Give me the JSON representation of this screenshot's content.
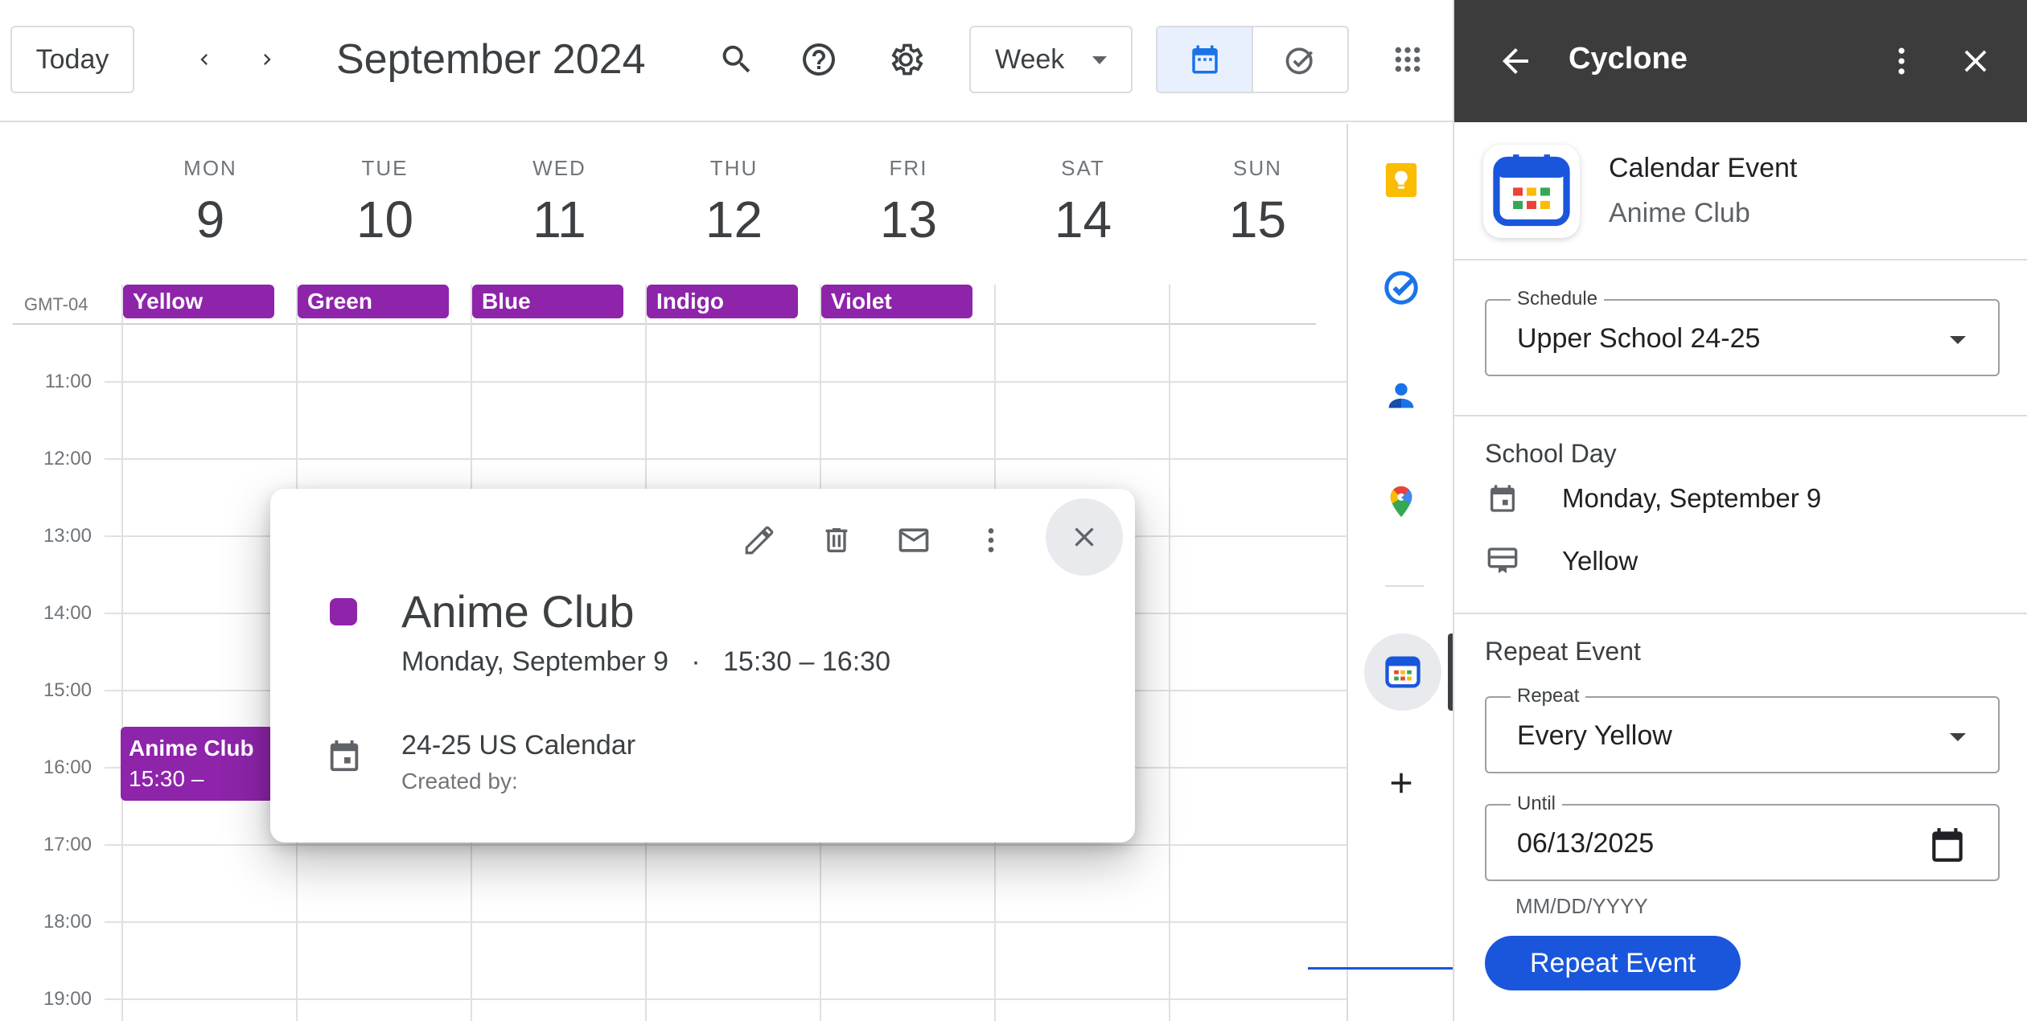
{
  "header": {
    "today_label": "Today",
    "month_title": "September 2024",
    "view_label": "Week"
  },
  "calendar": {
    "timezone": "GMT-04",
    "days": [
      {
        "name": "MON",
        "num": "9"
      },
      {
        "name": "TUE",
        "num": "10"
      },
      {
        "name": "WED",
        "num": "11"
      },
      {
        "name": "THU",
        "num": "12"
      },
      {
        "name": "FRI",
        "num": "13"
      },
      {
        "name": "SAT",
        "num": "14"
      },
      {
        "name": "SUN",
        "num": "15"
      }
    ],
    "day_chips": [
      "Yellow",
      "Green",
      "Blue",
      "Indigo",
      "Violet"
    ],
    "times": [
      "11:00",
      "12:00",
      "13:00",
      "14:00",
      "15:00",
      "16:00",
      "17:00",
      "18:00",
      "19:00"
    ],
    "event": {
      "title": "Anime Club",
      "time": "15:30 – 16:30"
    },
    "event_color": "#8e24aa"
  },
  "popup": {
    "title": "Anime Club",
    "date": "Monday, September 9",
    "separator": "·",
    "time": "15:30 – 16:30",
    "calendar_name": "24-25 US Calendar",
    "created_by": "Created by:"
  },
  "panel": {
    "title": "Cyclone",
    "card_title": "Calendar Event",
    "card_subtitle": "Anime Club",
    "schedule": {
      "label": "Schedule",
      "value": "Upper School 24-25"
    },
    "school_day": {
      "heading": "School Day",
      "date": "Monday, September 9",
      "day_color": "Yellow"
    },
    "repeat_event": {
      "heading": "Repeat Event",
      "repeat": {
        "label": "Repeat",
        "value": "Every Yellow"
      },
      "until": {
        "label": "Until",
        "value": "06/13/2025"
      },
      "date_hint": "MM/DD/YYYY",
      "button_label": "Repeat Event"
    },
    "accent_color": "#1a56db"
  },
  "icons": {
    "header": [
      "chevron-left-icon",
      "chevron-right-icon",
      "search-icon",
      "help-icon",
      "settings-icon",
      "calendar-icon",
      "task-check-icon",
      "apps-grid-icon"
    ],
    "rail": [
      "keep-icon",
      "tasks-icon",
      "contacts-icon",
      "maps-icon",
      "cyclone-icon",
      "add-icon"
    ]
  }
}
